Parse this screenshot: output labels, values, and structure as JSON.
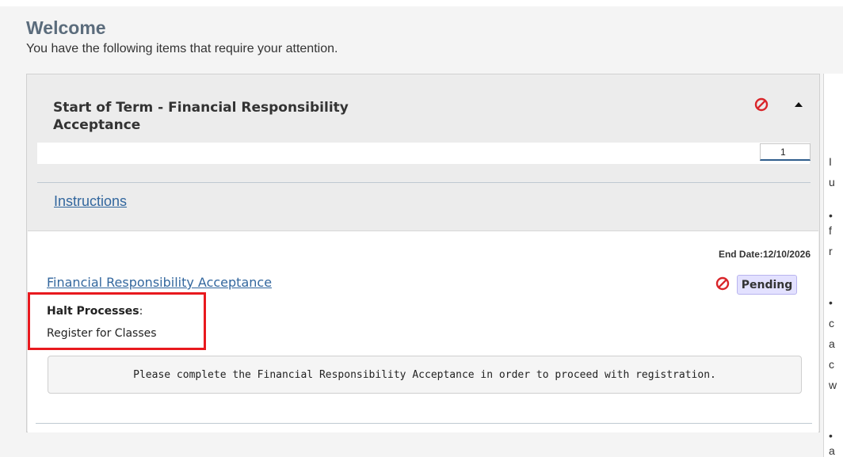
{
  "header": {
    "title": "Welcome",
    "subtitle": "You have the following items that require your attention."
  },
  "card": {
    "title": "Start of Term - Financial Responsibility Acceptance",
    "status_icon": "halt-icon",
    "collapse_icon": "caret-up-icon",
    "progress_value": "1",
    "instructions_label": "Instructions",
    "task": {
      "end_date": "End Date:12/10/2026",
      "name": "Financial Responsibility Acceptance",
      "status": "Pending",
      "halt_label": "Halt Processes",
      "halt_colon": ":",
      "halt_process": "Register for Classes",
      "message": "Please complete the Financial Responsibility Acceptance in order to proceed with registration."
    }
  },
  "side_panel": {
    "fragments": [
      "I",
      "u",
      "•",
      "f",
      "r",
      "•",
      "c",
      "a",
      "c",
      "w",
      "•",
      "a"
    ]
  },
  "colors": {
    "halt_red": "#d9252a",
    "link_blue": "#33679e",
    "pending_bg": "#e3e1ff",
    "highlight_red": "#e8191e"
  }
}
